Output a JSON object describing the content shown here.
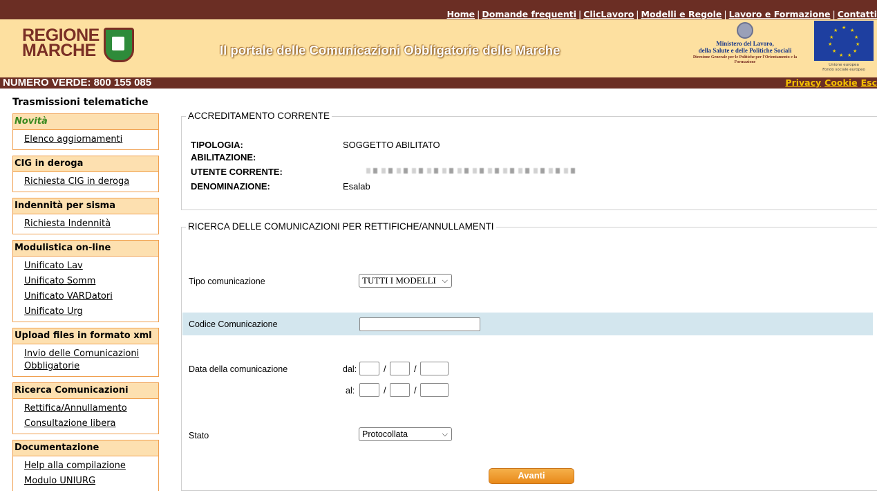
{
  "header": {
    "top_links": [
      "Home",
      "Domande frequenti",
      "ClicLavoro",
      "Modelli e Regole",
      "Lavoro e Formazione",
      "Contatti"
    ],
    "logo_text": [
      "REGIONE",
      "MARCHE"
    ],
    "portal_title": "Il portale delle Comunicazioni Obbligatorie delle Marche",
    "ministry": {
      "line1": "Ministero del Lavoro,",
      "line2": "della Salute e delle Politiche Sociali",
      "line3": "Direzione Generale per le Politiche per l'Orientamento e la Formazione"
    },
    "eu_caption": [
      "Unione europea",
      "Fondo sociale europeo"
    ],
    "numero_verde": "NUMERO VERDE: 800 155 085",
    "secondary_links": [
      "Privacy",
      "Cookie",
      "Esc"
    ]
  },
  "sidebar": {
    "title": "Trasmissioni telematiche",
    "sections": [
      {
        "header": "Novità",
        "items": [
          "Elenco aggiornamenti"
        ]
      },
      {
        "header": "CIG in deroga",
        "items": [
          "Richiesta CIG in deroga"
        ]
      },
      {
        "header": "Indennità per sisma",
        "items": [
          "Richiesta Indennità"
        ]
      },
      {
        "header": "Modulistica on-line",
        "items": [
          "Unificato Lav",
          "Unificato Somm",
          "Unificato VARDatori",
          "Unificato Urg"
        ]
      },
      {
        "header": "Upload files in formato xml",
        "items": [
          "Invio delle Comunicazioni Obbligatorie"
        ]
      },
      {
        "header": "Ricerca Comunicazioni",
        "items": [
          "Rettifica/Annullamento",
          "Consultazione libera"
        ]
      },
      {
        "header": "Documentazione",
        "items": [
          "Help alla compilazione",
          "Modulo UNIURG"
        ]
      }
    ]
  },
  "accreditamento": {
    "legend": "ACCREDITAMENTO CORRENTE",
    "tipologia_label": "TIPOLOGIA:",
    "abilitazione_label": "ABILITAZIONE:",
    "tipologia_value": "SOGGETTO ABILITATO",
    "utente_label": "UTENTE CORRENTE:",
    "denominazione_label": "DENOMINAZIONE:",
    "denominazione_value": "Esalab"
  },
  "ricerca": {
    "legend": "RICERCA DELLE COMUNICAZIONI PER RETTIFICHE/ANNULLAMENTI",
    "tipo_label": "Tipo comunicazione",
    "tipo_value": "TUTTI I MODELLI",
    "codice_label": "Codice Comunicazione",
    "codice_value": "",
    "data_label": "Data della comunicazione",
    "dal_label": "dal:",
    "al_label": "al:",
    "slash": "/",
    "stato_label": "Stato",
    "stato_value": "Protocollata",
    "submit_label": "Avanti"
  },
  "colors": {
    "topbar": "#6b2e24",
    "banner": "#fde0a0",
    "sidebar_border": "#f0a050",
    "highlight_row": "#d3e6ee",
    "button": "#e8891a"
  }
}
